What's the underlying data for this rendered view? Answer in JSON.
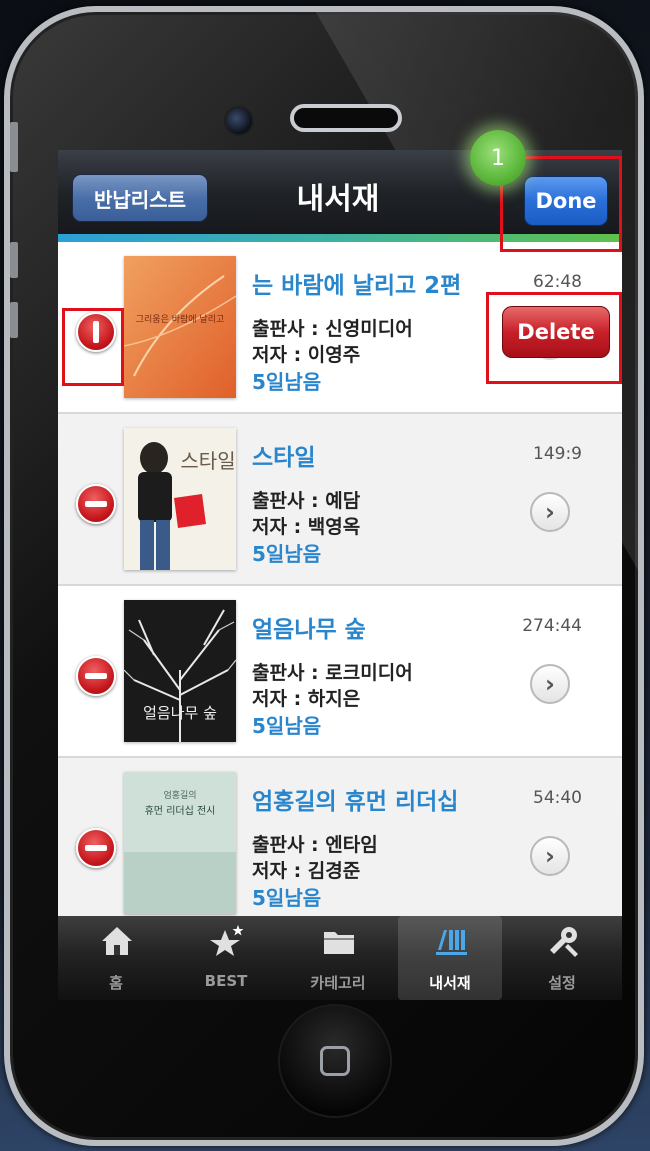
{
  "navbar": {
    "back_label": "반납리스트",
    "title": "내서재",
    "done_label": "Done"
  },
  "books": [
    {
      "title": "는 바람에 날리고 2편",
      "publisher": "출판사 : 신영미디어",
      "author": "저자 : 이영주",
      "remaining": "5일남음",
      "time": "62:48",
      "delete_label": "Delete"
    },
    {
      "title": "스타일",
      "publisher": "출판사 : 예담",
      "author": "저자 : 백영옥",
      "remaining": "5일남음",
      "time": "149:9"
    },
    {
      "title": "얼음나무 숲",
      "publisher": "출판사 : 로크미디어",
      "author": "저자 : 하지은",
      "remaining": "5일남음",
      "time": "274:44"
    },
    {
      "title": "엄홍길의 휴먼 리더십",
      "publisher": "출판사 : 엔타임",
      "author": "저자 : 김경준",
      "remaining": "5일남음",
      "time": "54:40"
    }
  ],
  "covers": {
    "book1_text": "그리움은 바람에 날리고",
    "book2_text": "스타일",
    "book3_text": "얼음나무 숲",
    "book4_line1": "엄홍길의",
    "book4_line2": "휴먼 리더십 전시"
  },
  "tabs": [
    {
      "label": "홈",
      "icon": "home-icon"
    },
    {
      "label": "BEST",
      "icon": "star-icon"
    },
    {
      "label": "카테고리",
      "icon": "folder-icon"
    },
    {
      "label": "내서재",
      "icon": "bookshelf-icon",
      "active": true
    },
    {
      "label": "설정",
      "icon": "settings-icon"
    }
  ],
  "callout": {
    "number": "1"
  },
  "colors": {
    "title_blue": "#2a86cc",
    "done_blue": "#2a6fd8",
    "delete_red": "#c8202a",
    "highlight_red": "#e0101a",
    "badge_green": "#5bb63a"
  }
}
